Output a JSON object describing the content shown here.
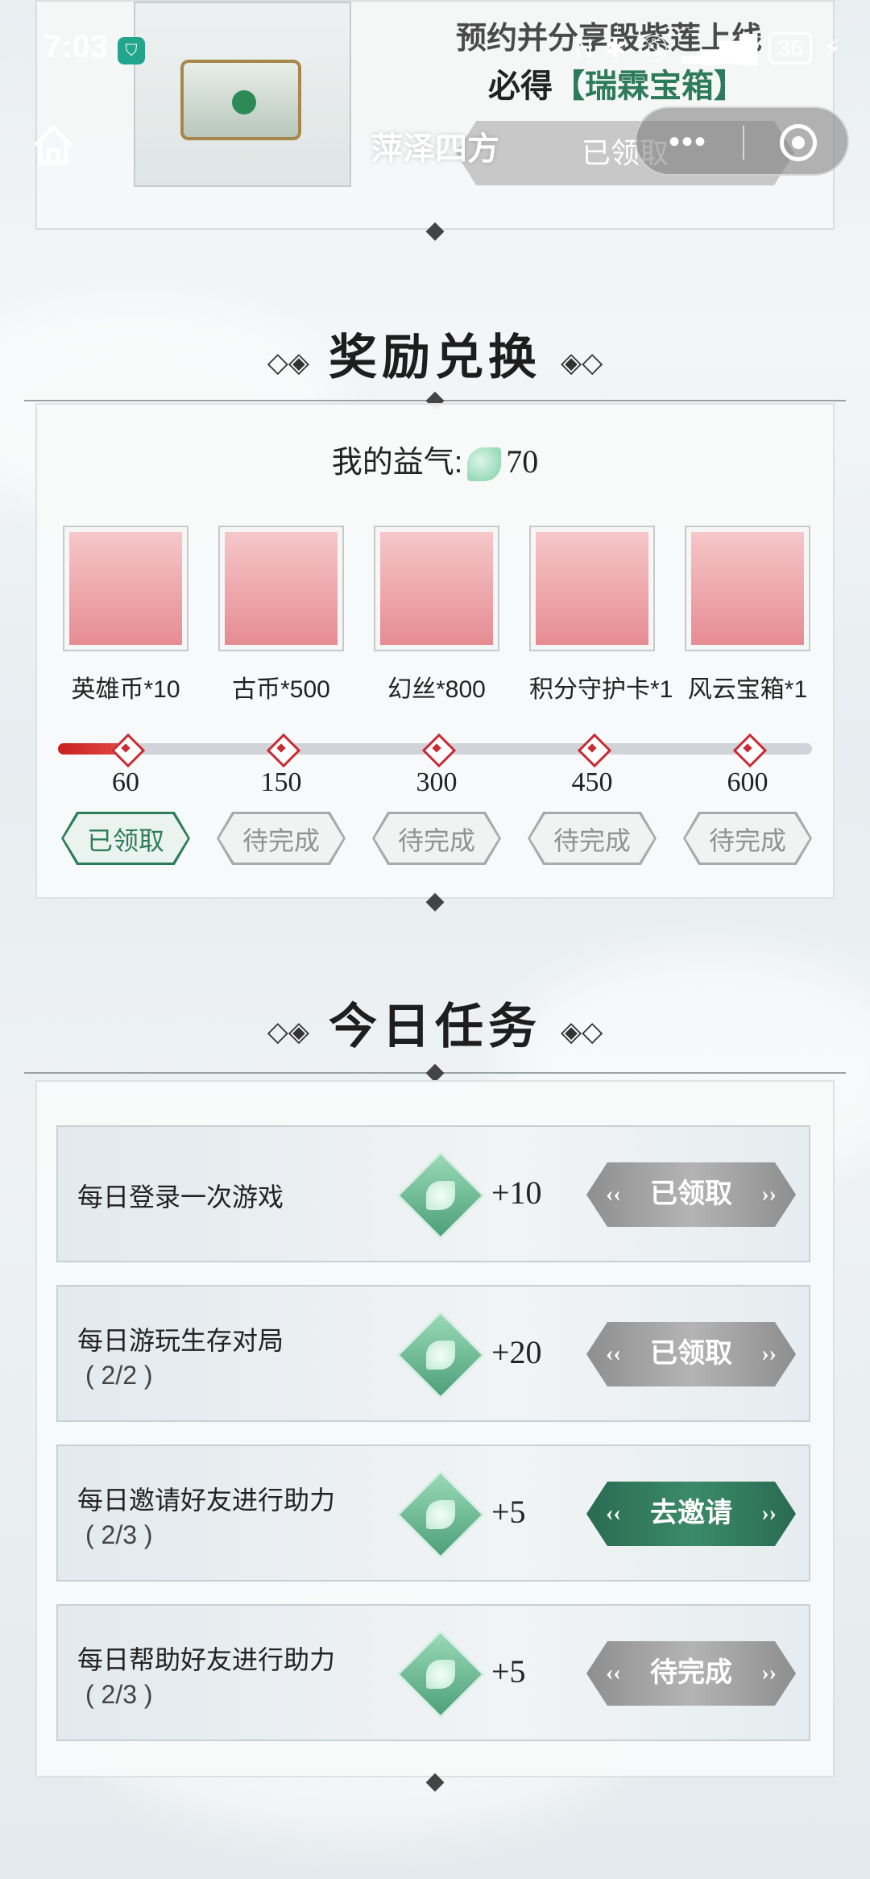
{
  "status_bar": {
    "time": "7:03",
    "battery": "36"
  },
  "nav": {
    "title": "萍泽四方",
    "more": "•••"
  },
  "banner": {
    "line1": "预约并分享毁紫莲上线",
    "line2_prefix": "必得",
    "line2_highlight": "【瑞霖宝箱】",
    "button": "已领取"
  },
  "reward_exchange": {
    "title": "奖励兑换",
    "qi_label": "我的益气:",
    "qi_value": "70",
    "progress_fraction": 0.0935,
    "rewards": [
      {
        "name": "英雄币*10",
        "threshold": "60",
        "state": "已领取",
        "status": "done"
      },
      {
        "name": "古币*500",
        "threshold": "150",
        "state": "待完成",
        "status": "wait"
      },
      {
        "name": "幻丝*800",
        "threshold": "300",
        "state": "待完成",
        "status": "wait"
      },
      {
        "name": "积分守护卡*1",
        "threshold": "450",
        "state": "待完成",
        "status": "wait"
      },
      {
        "name": "风云宝箱*1",
        "threshold": "600",
        "state": "待完成",
        "status": "wait"
      }
    ]
  },
  "tasks_section": {
    "title": "今日任务",
    "tasks": [
      {
        "name": "每日登录一次游戏",
        "progress": "",
        "reward": "+10",
        "button": "已领取",
        "style": "gray"
      },
      {
        "name": "每日游玩生存对局",
        "progress": "( 2/2 )",
        "reward": "+20",
        "button": "已领取",
        "style": "gray"
      },
      {
        "name": "每日邀请好友进行助力",
        "progress": "( 2/3 )",
        "reward": "+5",
        "button": "去邀请",
        "style": "green"
      },
      {
        "name": "每日帮助好友进行助力",
        "progress": "( 2/3 )",
        "reward": "+5",
        "button": "待完成",
        "style": "gray"
      }
    ]
  }
}
